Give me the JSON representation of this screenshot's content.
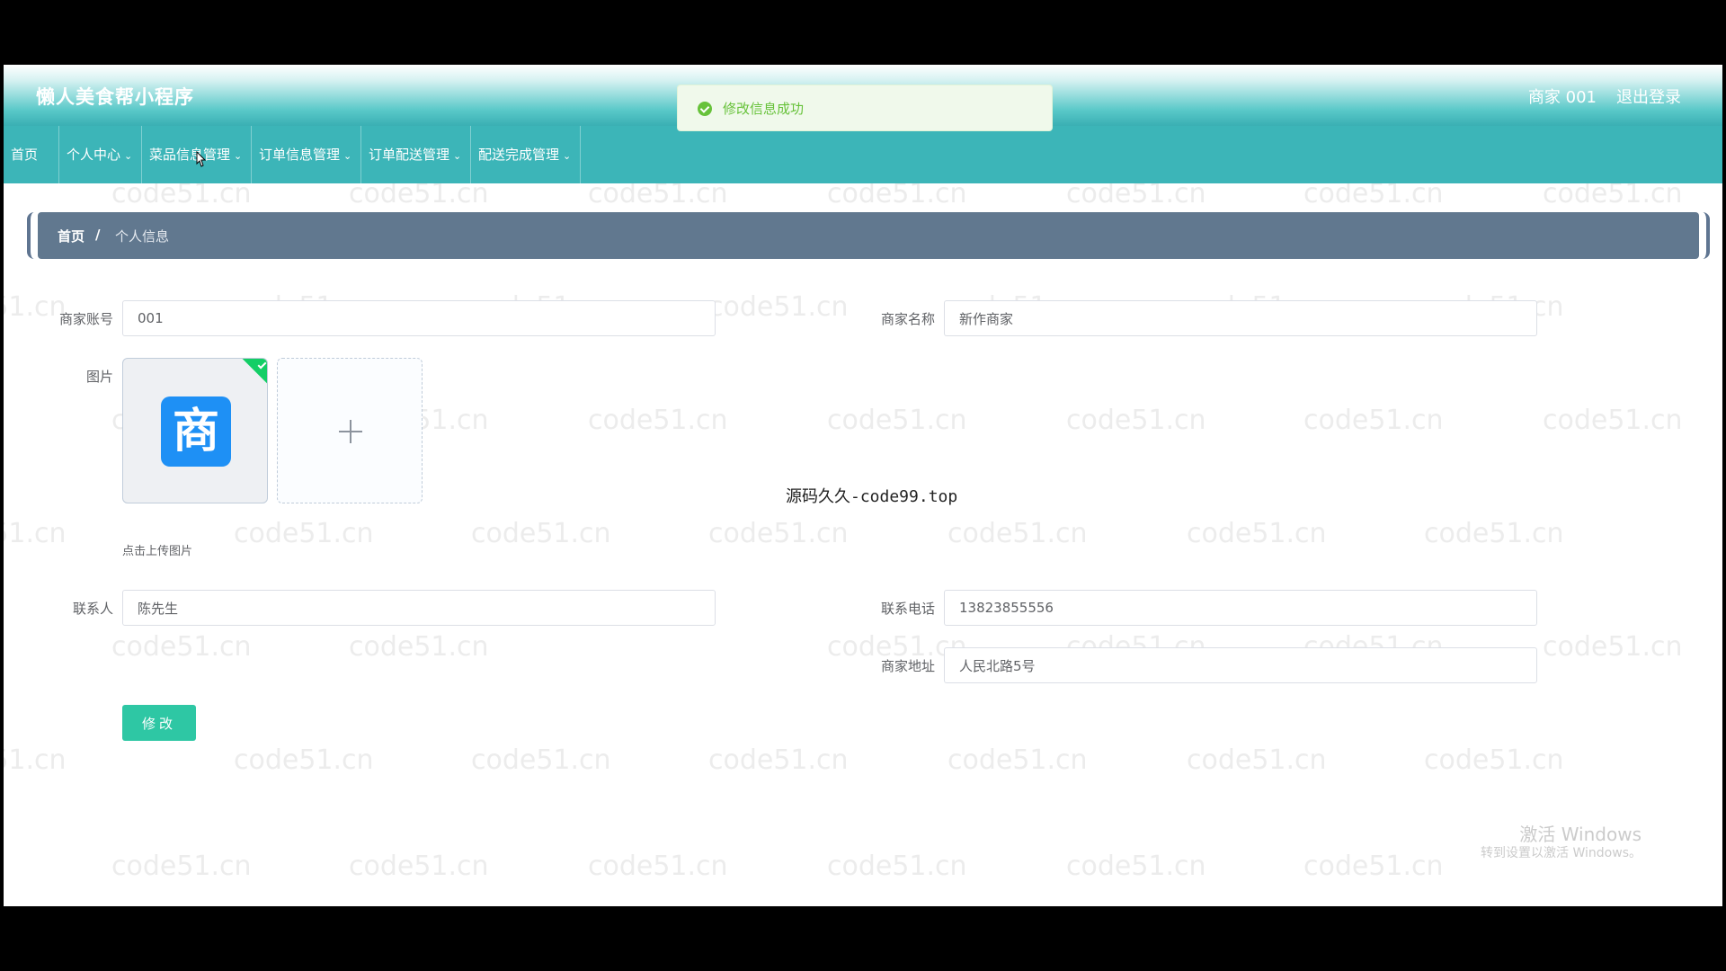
{
  "header": {
    "title": "懒人美食帮小程序",
    "user": "商家 001",
    "logout": "退出登录"
  },
  "toast": {
    "message": "修改信息成功"
  },
  "nav": {
    "items": [
      {
        "label": "首页"
      },
      {
        "label": "个人中心"
      },
      {
        "label": "菜品信息管理"
      },
      {
        "label": "订单信息管理"
      },
      {
        "label": "订单配送管理"
      },
      {
        "label": "配送完成管理"
      }
    ]
  },
  "breadcrumb": {
    "home": "首页",
    "separator": "/",
    "current": "个人信息"
  },
  "form": {
    "account_label": "商家账号",
    "account_value": "001",
    "name_label": "商家名称",
    "name_value": "新作商家",
    "image_label": "图片",
    "image_glyph": "商",
    "upload_hint": "点击上传图片",
    "contact_label": "联系人",
    "contact_value": "陈先生",
    "phone_label": "联系电话",
    "phone_value": "13823855556",
    "address_label": "商家地址",
    "address_value": "人民北路5号",
    "submit_label": "修改"
  },
  "overlay_text": "源码久久-code99.top",
  "watermark": "code51.cn",
  "os_notice": {
    "title": "激活 Windows",
    "subtitle": "转到设置以激活 Windows。"
  },
  "colors": {
    "nav_bg": "#3cb5b8",
    "breadcrumb_bg": "#61788f",
    "submit_bg": "#2ec7a4",
    "toast_text": "#67c23a"
  }
}
